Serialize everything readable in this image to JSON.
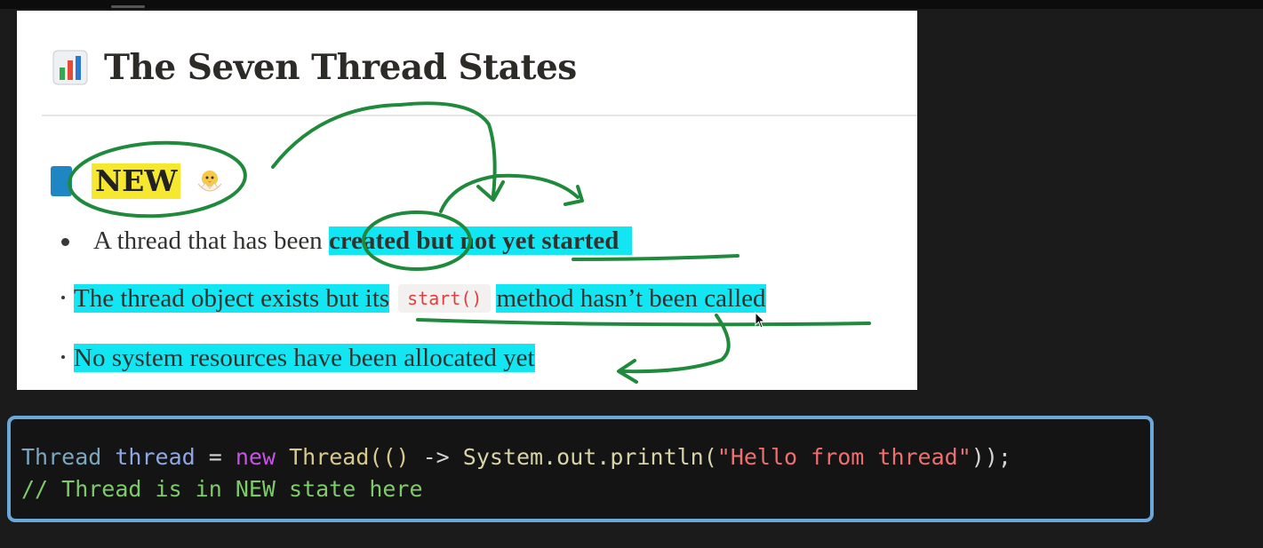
{
  "slide": {
    "title_icon": "bar-chart-icon",
    "title": "The Seven Thread States",
    "section": {
      "number_badge": "blue-number-badge",
      "label": "NEW",
      "emoji": "hatching-chick-icon"
    },
    "bullets": [
      {
        "plain": "A thread that has been ",
        "bold": "created but not yet started"
      },
      {
        "part1": "The thread object exists but its",
        "code": "start()",
        "part2": "method hasn’t been called"
      },
      {
        "text": "No system resources have been allocated yet"
      }
    ],
    "colors": {
      "highlight": "#12e6f2",
      "ink": "#1f8a3c",
      "label_highlight": "#f6e72f"
    }
  },
  "code": {
    "line1": {
      "t1": "Thread",
      "t2": "thread",
      "t3": "=",
      "t4": "new",
      "t5": "Thread(()",
      "t6": "->",
      "t7": "System.out.println(",
      "t8": "\"Hello from thread\"",
      "t9": "));"
    },
    "line2": "// Thread is in NEW state here",
    "border_color": "#6aa8dc"
  }
}
